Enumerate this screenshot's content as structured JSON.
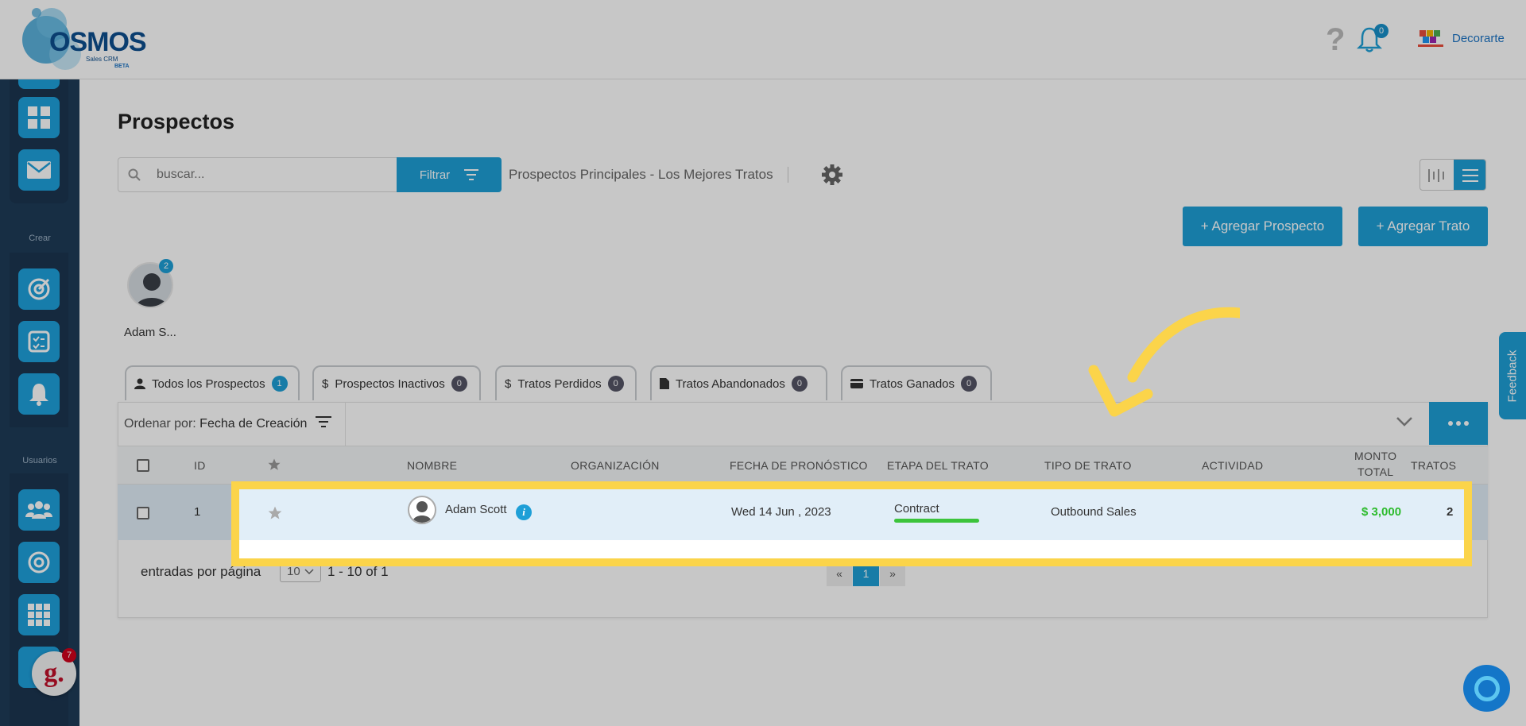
{
  "header": {
    "logo_text": "OSMOS",
    "logo_subtitle": "Sales CRM",
    "logo_beta": "BETA",
    "notifications_count": "0",
    "company_name": "Decorarte"
  },
  "sidebar": {
    "crear_label": "Crear",
    "usuarios_label": "Usuarios"
  },
  "page": {
    "title": "Prospectos",
    "search_placeholder": "buscar...",
    "filter_label": "Filtrar",
    "pipeline_name": "Prospectos Principales - Los Mejores Tratos",
    "add_prospect_label": "+ Agregar Prospecto",
    "add_deal_label": "+ Agregar Trato"
  },
  "user_filter": {
    "name": "Adam S...",
    "badge": "2"
  },
  "tabs": [
    {
      "label": "Todos los Prospectos",
      "count": "1"
    },
    {
      "label": "Prospectos Inactivos",
      "count": "0"
    },
    {
      "label": "Tratos Perdidos",
      "count": "0"
    },
    {
      "label": "Tratos Abandonados",
      "count": "0"
    },
    {
      "label": "Tratos Ganados",
      "count": "0"
    }
  ],
  "sort": {
    "label": "Ordenar por:",
    "value": "Fecha de Creación"
  },
  "table": {
    "columns": {
      "id": "ID",
      "name": "NOMBRE",
      "org": "ORGANIZACIÓN",
      "forecast": "FECHA DE PRONÓSTICO",
      "stage": "ETAPA DEL TRATO",
      "type": "TIPO DE TRATO",
      "activity": "ACTIVIDAD",
      "amount_1": "MONTO",
      "amount_2": "TOTAL",
      "deals": "TRATOS"
    },
    "rows": [
      {
        "id": "1",
        "name": "Adam Scott",
        "org": "",
        "forecast": "Wed 14 Jun , 2023",
        "stage": "Contract",
        "type": "Outbound Sales",
        "activity": "",
        "amount": "$ 3,000",
        "deals": "2"
      }
    ]
  },
  "pagination": {
    "per_page_label": "entradas por página",
    "per_page_value": "10",
    "range": "1 - 10 of 1",
    "prev": "«",
    "current": "1",
    "next": "»"
  },
  "feedback_label": "Feedback",
  "help_badge": "7",
  "colors": {
    "accent": "#1e9fd7",
    "sidebar": "#1e3c58",
    "highlight": "#fbd44a",
    "stage_bar": "#3cc43c",
    "amount": "#2dbb2d"
  }
}
